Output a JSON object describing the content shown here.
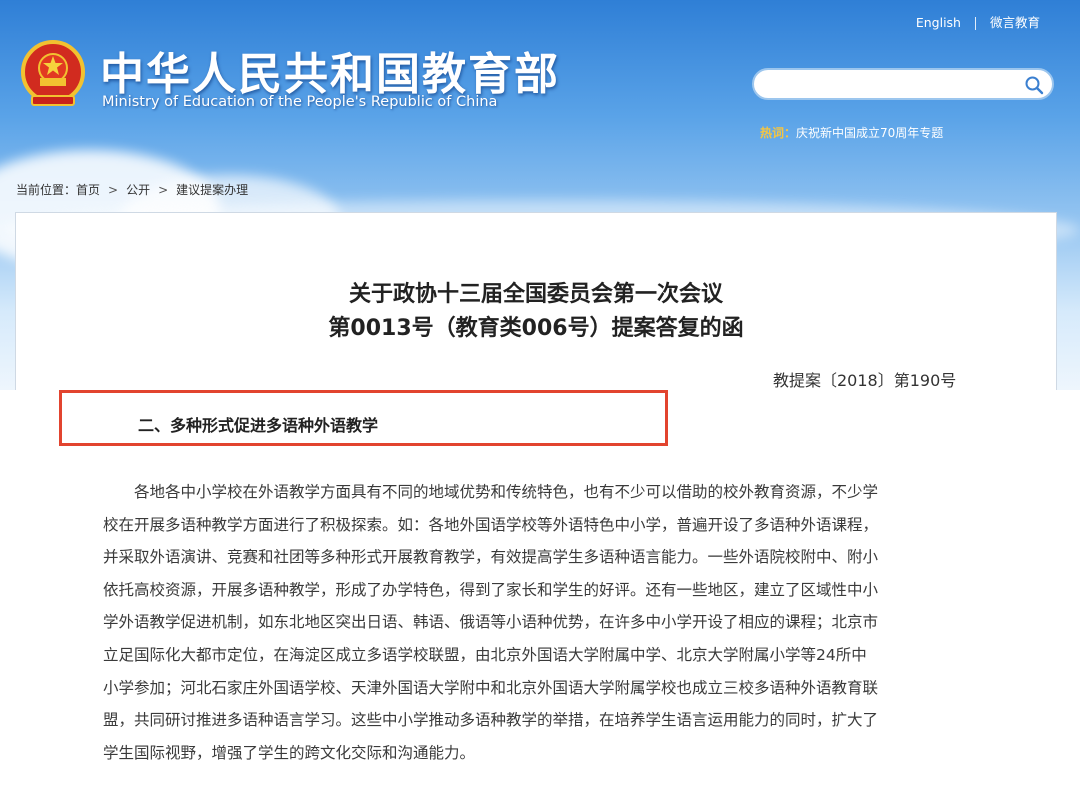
{
  "header": {
    "logo_cn": "中华人民共和国教育部",
    "logo_en": "Ministry of Education of the People's Republic of China",
    "links": [
      "English",
      "微言教育"
    ],
    "search_placeholder": "",
    "hot_label": "热词：",
    "hot_text": "庆祝新中国成立70周年专题"
  },
  "breadcrumb": {
    "prefix": "当前位置：",
    "items": [
      "首页",
      "公开",
      "建议提案办理"
    ],
    "separator": ">"
  },
  "doc": {
    "title_line1": "关于政协十三届全国委员会第一次会议",
    "title_line2": "第0013号（教育类006号）提案答复的函",
    "doc_number": "教提案〔2018〕第190号",
    "section_title": "二、多种形式促进多语种外语教学",
    "paragraph_lines": [
      "　　各地各中小学校在外语教学方面具有不同的地域优势和传统特色，也有不少可以借助的校外教育资源，不少学",
      "校在开展多语种教学方面进行了积极探索。如：各地外国语学校等外语特色中小学，普遍开设了多语种外语课程，",
      "并采取外语演讲、竞赛和社团等多种形式开展教育教学，有效提高学生多语种语言能力。一些外语院校附中、附小",
      "依托高校资源，开展多语种教学，形成了办学特色，得到了家长和学生的好评。还有一些地区，建立了区域性中小",
      "学外语教学促进机制，如东北地区突出日语、韩语、俄语等小语种优势，在许多中小学开设了相应的课程；北京市",
      "立足国际化大都市定位，在海淀区成立多语学校联盟，由北京外国语大学附属中学、北京大学附属小学等24所中",
      "小学参加；河北石家庄外国语学校、天津外国语大学附中和北京外国语大学附属学校也成立三校多语种外语教育联",
      "盟，共同研讨推进多语种语言学习。这些中小学推动多语种教学的举措，在培养学生语言运用能力的同时，扩大了",
      "学生国际视野，增强了学生的跨文化交际和沟通能力。"
    ]
  },
  "colors": {
    "highlight_border": "#e2442f",
    "hot_keyword": "#f4c542"
  },
  "icons": [
    "national-emblem-icon",
    "search-icon"
  ]
}
